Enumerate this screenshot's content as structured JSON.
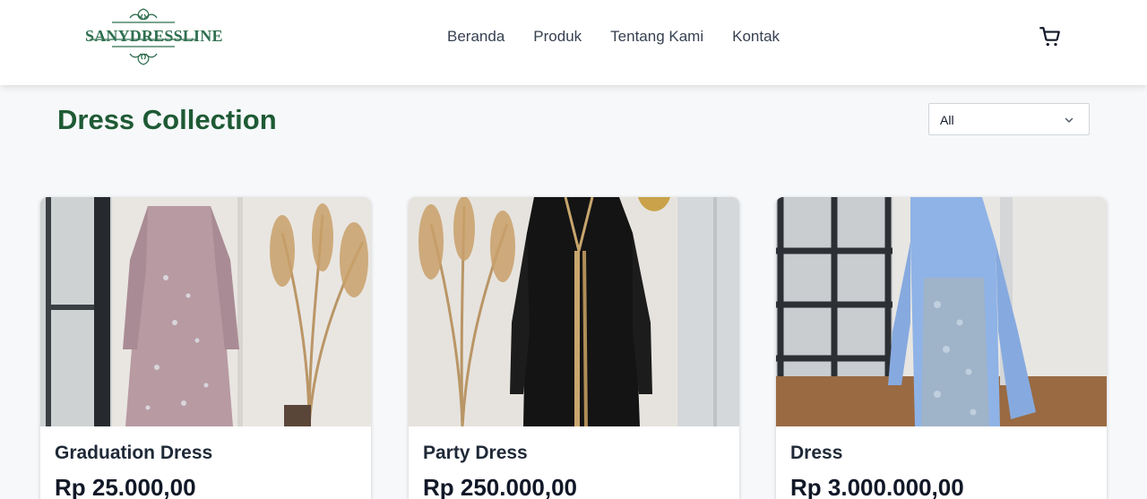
{
  "header": {
    "logo_text": "SANYDRESSLINE",
    "nav": [
      "Beranda",
      "Produk",
      "Tentang Kami",
      "Kontak"
    ],
    "cart_icon": "cart-icon"
  },
  "main": {
    "title": "Dress Collection",
    "filter": {
      "selected": "All"
    }
  },
  "products": [
    {
      "name": "Graduation Dress",
      "price": "Rp 25.000,00"
    },
    {
      "name": "Party Dress",
      "price": "Rp 250.000,00"
    },
    {
      "name": "Dress",
      "price": "Rp 3.000.000,00"
    }
  ],
  "colors": {
    "accent": "#1e5a34",
    "logo": "#2f6f4f"
  }
}
